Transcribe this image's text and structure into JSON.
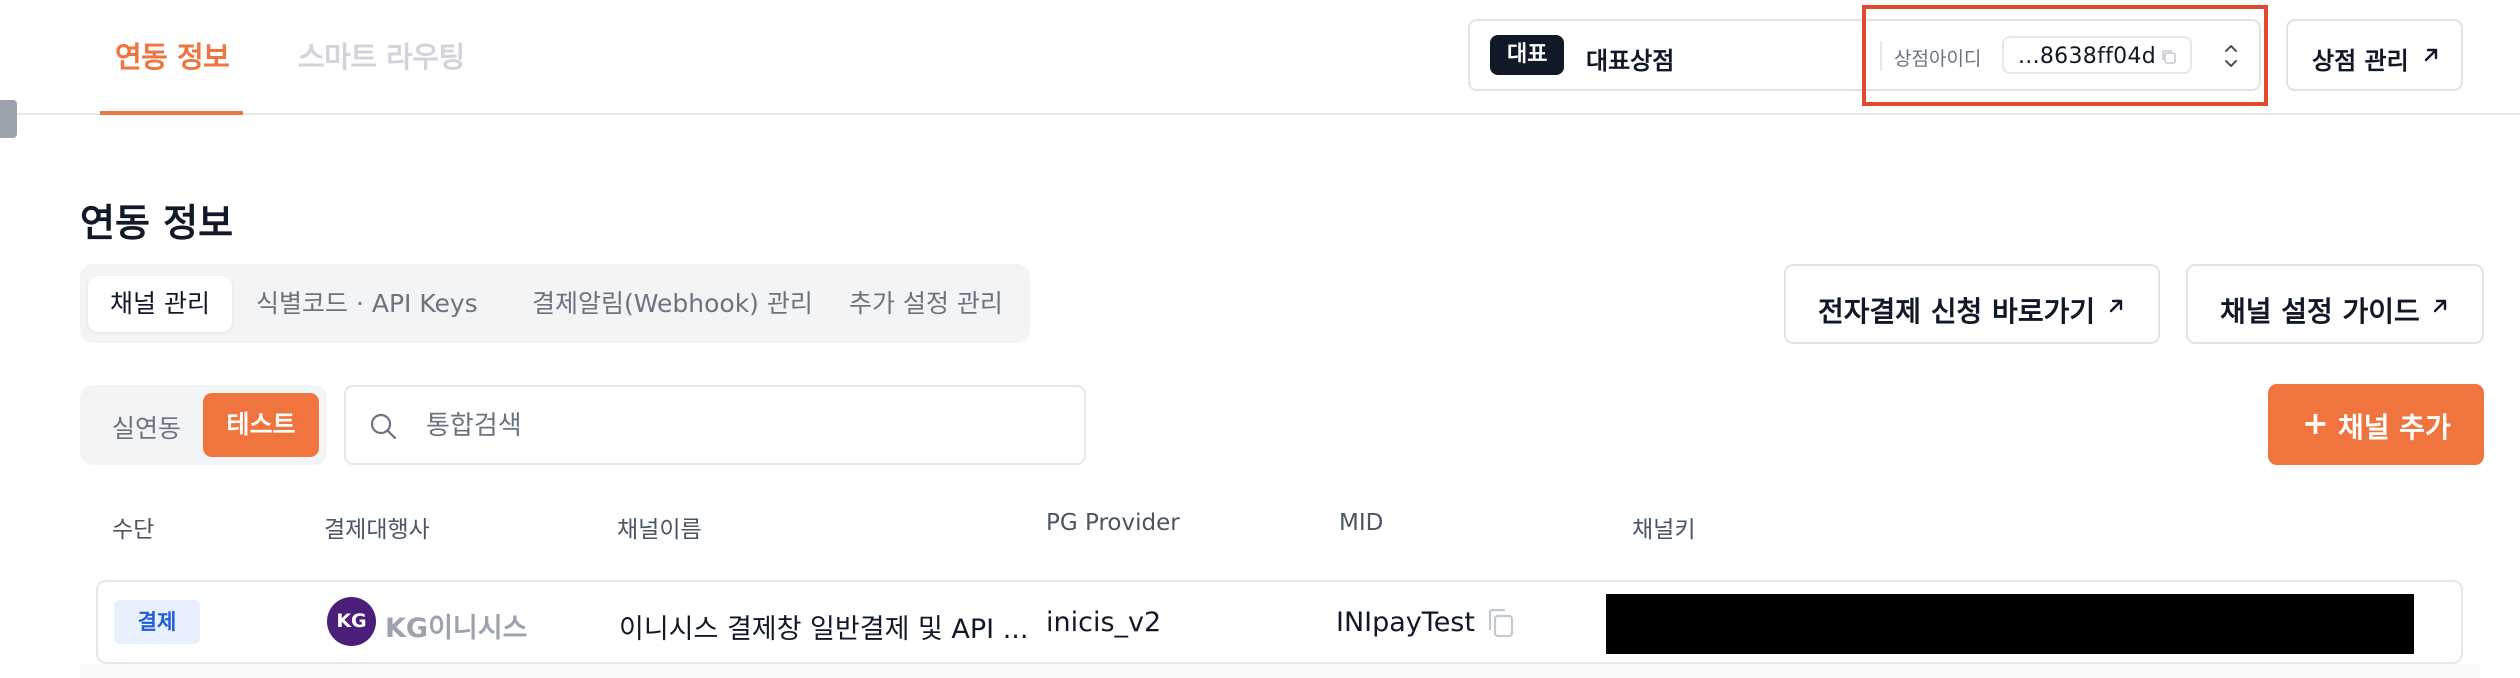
{
  "nav": {
    "tabs": [
      {
        "label": "연동 정보",
        "active": true
      },
      {
        "label": "스마트 라우팅",
        "active": false
      }
    ]
  },
  "store_selector": {
    "badge": "대표",
    "store_name": "대표상점",
    "id_label": "상점아이디",
    "id_value": "...8638ff04d"
  },
  "manage_button": {
    "label": "상점 관리"
  },
  "page": {
    "title": "연동 정보"
  },
  "subtabs": [
    {
      "label": "채널 관리",
      "active": true
    },
    {
      "label": "식별코드 · API Keys",
      "active": false
    },
    {
      "label": "결제알림(Webhook) 관리",
      "active": false
    },
    {
      "label": "추가 설정 관리",
      "active": false
    }
  ],
  "actions": {
    "apply_label": "전자결제 신청 바로가기",
    "guide_label": "채널 설정 가이드",
    "add_channel_label": "채널 추가",
    "add_channel_icon": "+"
  },
  "mode_toggle": {
    "real": "실연동",
    "test": "테스트",
    "selected": "test"
  },
  "search": {
    "placeholder": "통합검색",
    "value": ""
  },
  "table": {
    "headers": [
      "수단",
      "결제대행사",
      "채널이름",
      "PG Provider",
      "MID",
      "채널키"
    ],
    "rows": [
      {
        "method": "결제",
        "pg_logo": "KG",
        "pg_name": "KG이니시스",
        "channel_name": "이니시스 결제창 일반결제 및 API ...",
        "pg_provider": "inicis_v2",
        "mid": "INIpayTest",
        "channel_key": ""
      }
    ]
  },
  "colors": {
    "accent": "#f0743e",
    "highlight": "#e04a2f",
    "method_badge_bg": "#e8f0fd",
    "method_badge_text": "#1e5bd8",
    "inicis_logo": "#4b1e7a"
  },
  "icons": [
    "copy-icon",
    "chevron-updown-icon",
    "arrow-up-right-icon",
    "search-icon",
    "plus-icon"
  ]
}
